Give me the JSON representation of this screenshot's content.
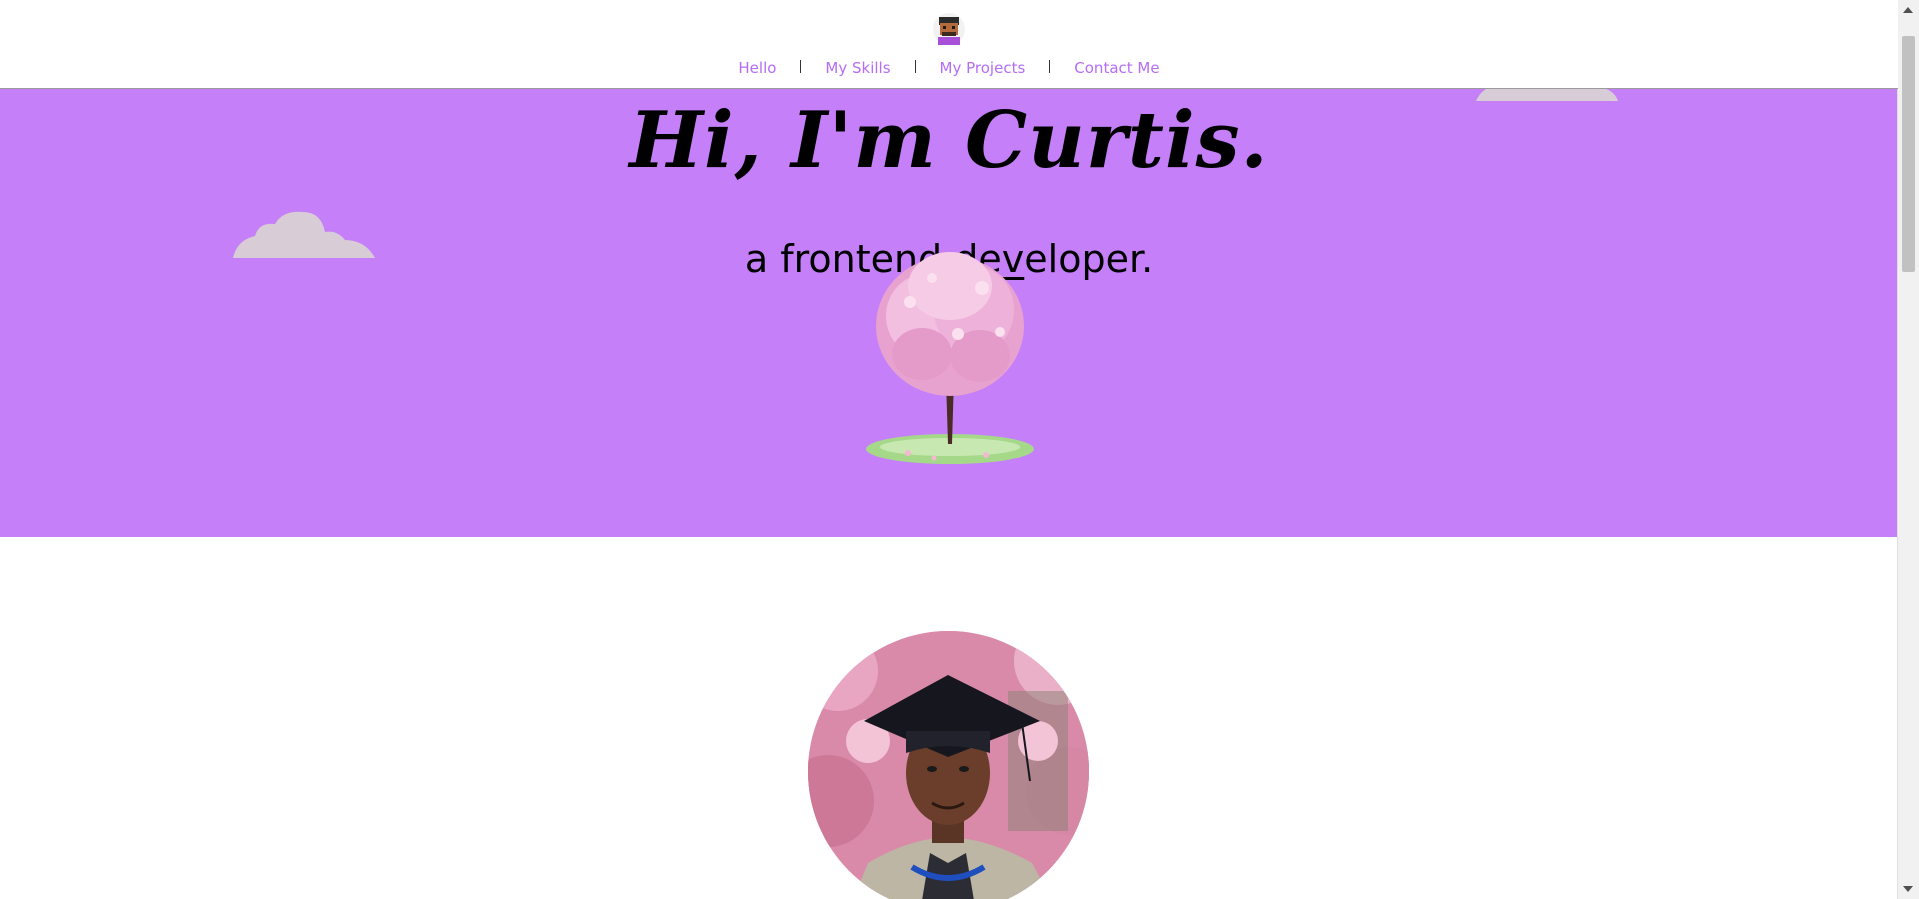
{
  "colors": {
    "accent": "#c47ff9",
    "nav_link": "#b56df5",
    "cloud": "#d8ccd6"
  },
  "header": {
    "logo_icon": "developer-avatar-icon",
    "nav": [
      {
        "label": "Hello"
      },
      {
        "label": "My Skills"
      },
      {
        "label": "My Projects"
      },
      {
        "label": "Contact Me"
      }
    ]
  },
  "hero": {
    "title": "Hi, I'm Curtis.",
    "subtitle_prefix": "a frontend ",
    "subtitle_underlined": "dev",
    "subtitle_suffix": "eloper."
  },
  "about": {
    "portrait_icon": "graduation-portrait-photo"
  }
}
